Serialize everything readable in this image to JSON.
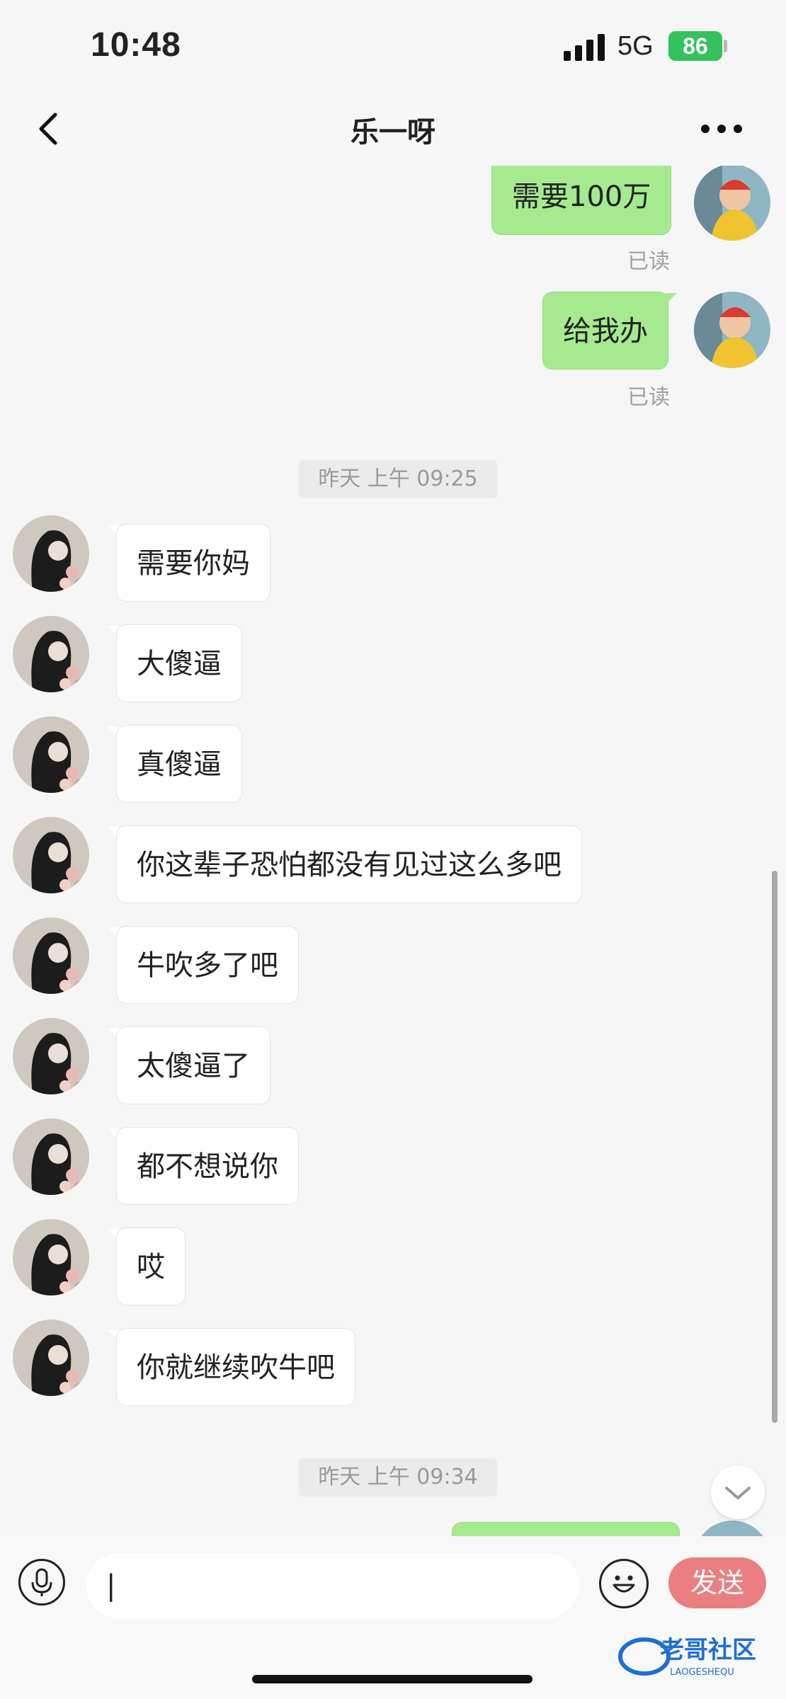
{
  "status_bar": {
    "time": "10:48",
    "network": "5G",
    "battery": "86"
  },
  "header": {
    "title": "乐一呀"
  },
  "messages": {
    "out_1": {
      "text": "需要100万",
      "status": "已读"
    },
    "out_2": {
      "text": "给我办",
      "status": "已读"
    },
    "separator_1": "昨天 上午 09:25",
    "in": [
      "需要你妈",
      "大傻逼",
      "真傻逼",
      "你这辈子恐怕都没有见过这么多吧",
      "牛吹多了吧",
      "太傻逼了",
      "都不想说你",
      "哎",
      "你就继续吹牛吧"
    ],
    "separator_2": "昨天 上午 09:34"
  },
  "input_bar": {
    "input_value": "|",
    "send_label": "发送"
  },
  "watermark": {
    "text": "老哥社区",
    "subtext": "LAOGESHEQU"
  },
  "colors": {
    "outgoing_bubble": "#a6ea90",
    "incoming_bubble": "#ffffff",
    "send_button": "#eb7e80",
    "battery": "#33c25b"
  }
}
